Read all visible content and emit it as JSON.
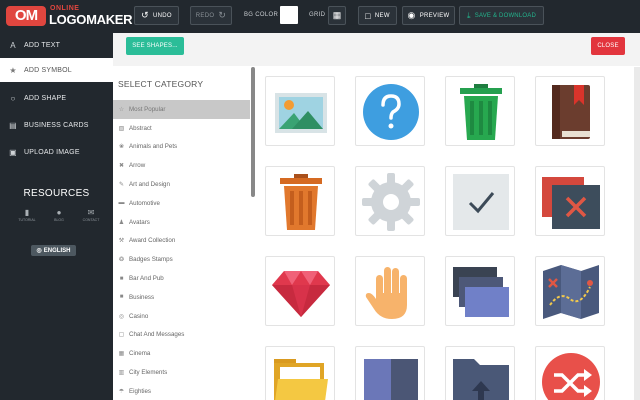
{
  "logo": {
    "mark": "OM",
    "sub": "ONLINE",
    "main": "LOGOMAKER"
  },
  "toolbar": {
    "undo": "UNDO",
    "redo": "REDO",
    "bg_color_label": "BG COLOR",
    "bg_color_value": "#ffffff",
    "grid_label": "GRID",
    "new": "NEW",
    "preview": "PREVIEW",
    "save": "SAVE & DOWNLOAD"
  },
  "sidebar": {
    "items": [
      {
        "label": "ADD TEXT",
        "icon": "text-icon"
      },
      {
        "label": "ADD SYMBOL",
        "icon": "star-icon"
      },
      {
        "label": "ADD SHAPE",
        "icon": "circle-icon"
      },
      {
        "label": "BUSINESS CARDS",
        "icon": "card-icon"
      },
      {
        "label": "UPLOAD IMAGE",
        "icon": "image-icon"
      }
    ],
    "resources_title": "RESOURCES",
    "resources": [
      {
        "label": "TUTORIAL",
        "icon": "book-icon"
      },
      {
        "label": "BLOG",
        "icon": "chat-icon"
      },
      {
        "label": "CONTACT",
        "icon": "mail-icon"
      }
    ],
    "language": "ENGLISH"
  },
  "main": {
    "see_shapes": "SEE SHAPES...",
    "close": "CLOSE",
    "category_title": "SELECT CATEGORY",
    "categories": [
      {
        "label": "Most Popular",
        "icon": "star-icon"
      },
      {
        "label": "Abstract",
        "icon": "abstract-icon"
      },
      {
        "label": "Animals and Pets",
        "icon": "paw-icon"
      },
      {
        "label": "Arrow",
        "icon": "arrow-icon"
      },
      {
        "label": "Art and Design",
        "icon": "brush-icon"
      },
      {
        "label": "Automotive",
        "icon": "car-icon"
      },
      {
        "label": "Avatars",
        "icon": "person-icon"
      },
      {
        "label": "Award Collection",
        "icon": "award-icon"
      },
      {
        "label": "Badges Stamps",
        "icon": "badge-icon"
      },
      {
        "label": "Bar And Pub",
        "icon": "glass-icon"
      },
      {
        "label": "Business",
        "icon": "briefcase-icon"
      },
      {
        "label": "Casino",
        "icon": "chip-icon"
      },
      {
        "label": "Chat And Messages",
        "icon": "chat-icon"
      },
      {
        "label": "Cinema",
        "icon": "film-icon"
      },
      {
        "label": "City Elements",
        "icon": "building-icon"
      },
      {
        "label": "Eighties",
        "icon": "umbrella-icon"
      }
    ],
    "symbols": [
      "landscape-picture-icon",
      "question-icon",
      "trash-can-green-icon",
      "book-bookmark-icon",
      "trash-can-orange-icon",
      "gear-icon",
      "checkmark-icon",
      "close-window-icon",
      "ruby-gem-icon",
      "hand-icon",
      "windows-stack-icon",
      "treasure-map-icon",
      "folder-open-icon",
      "book-closed-icon",
      "folder-upload-icon",
      "shuffle-icon"
    ]
  }
}
